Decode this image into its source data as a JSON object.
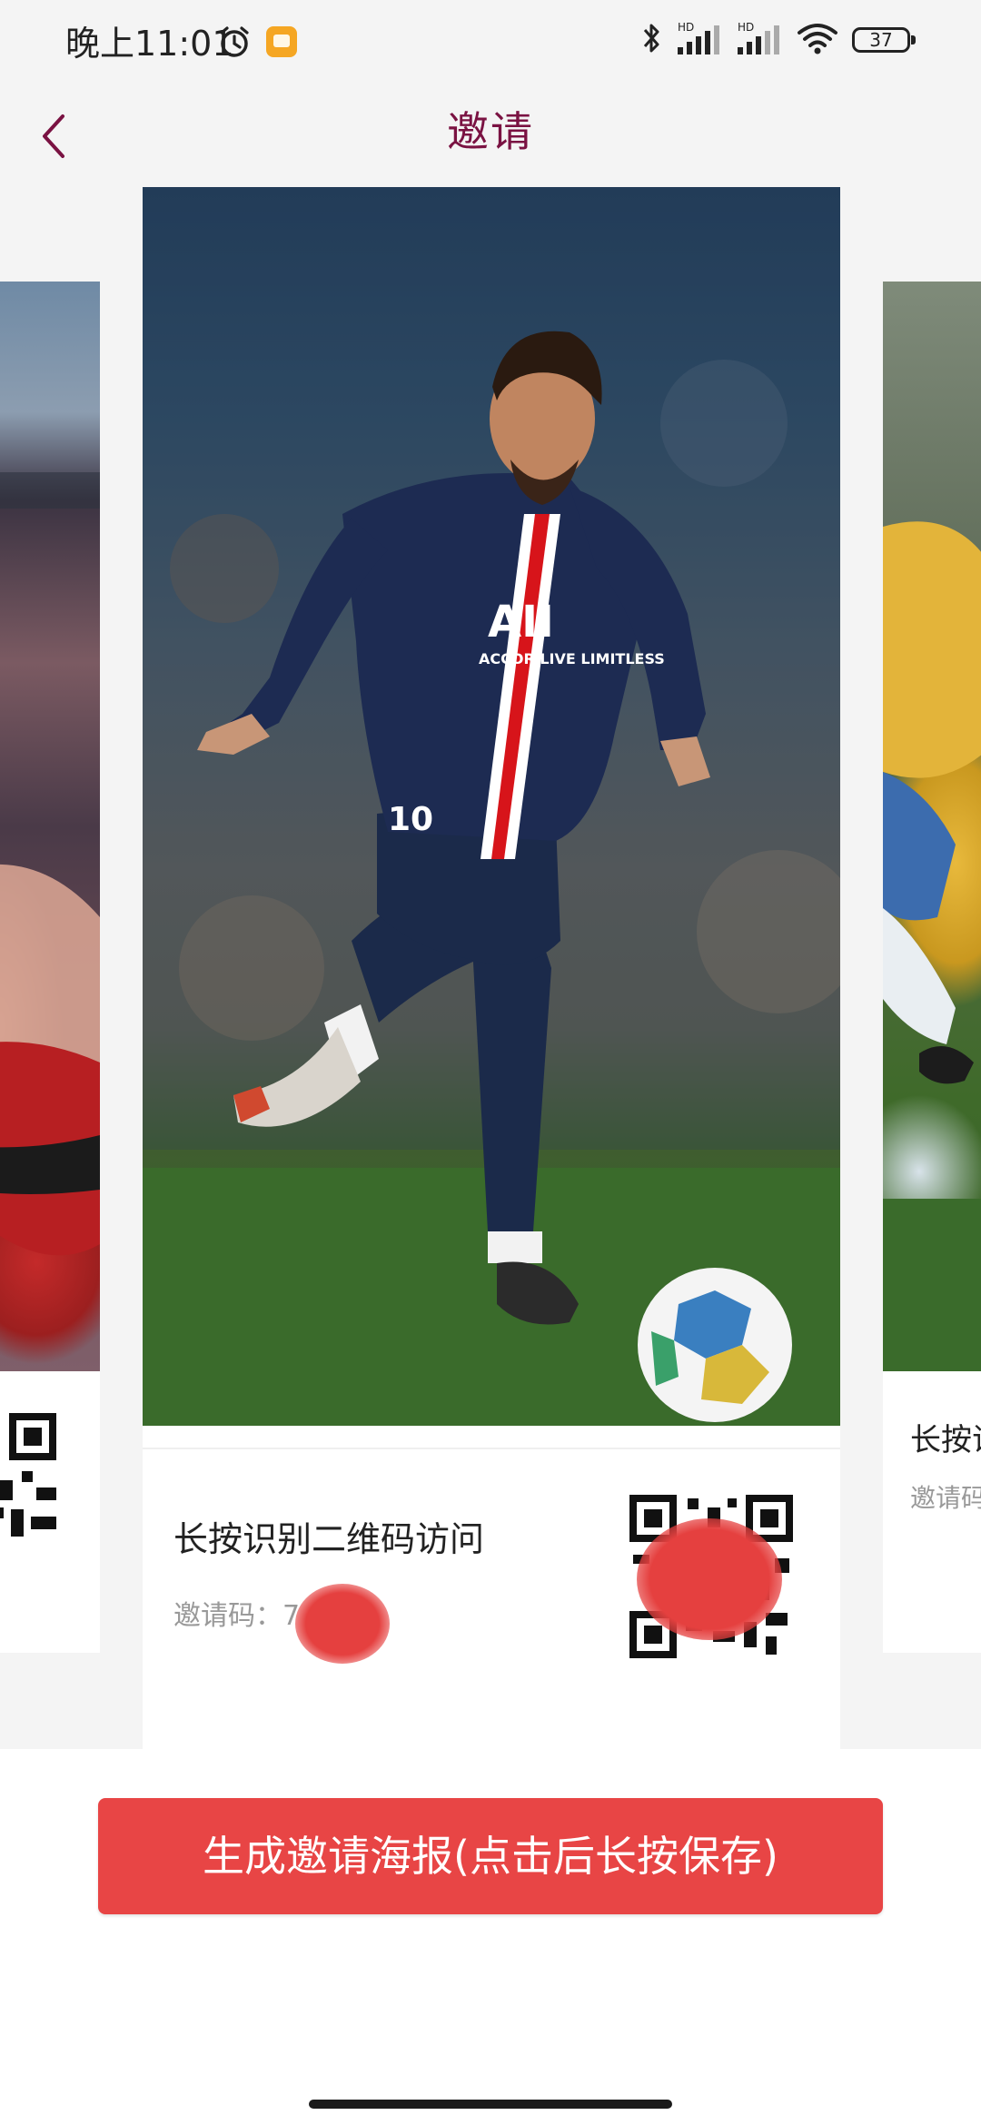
{
  "status_bar": {
    "time": "晚上11:01",
    "network_1": "HD",
    "network_2": "HD",
    "battery": "37"
  },
  "header": {
    "title": "邀请"
  },
  "poster": {
    "scan_text": "长按识别二维码访问",
    "invite_code_label": "邀请码：",
    "invite_code_value": "7    6"
  },
  "side_cards": {
    "right_text": "长按识",
    "right_subtext": "邀请码"
  },
  "actions": {
    "generate_label": "生成邀请海报(点击后长按保存)"
  },
  "colors": {
    "title": "#7a1242",
    "button": "#e84545",
    "background": "#f4f4f4"
  }
}
